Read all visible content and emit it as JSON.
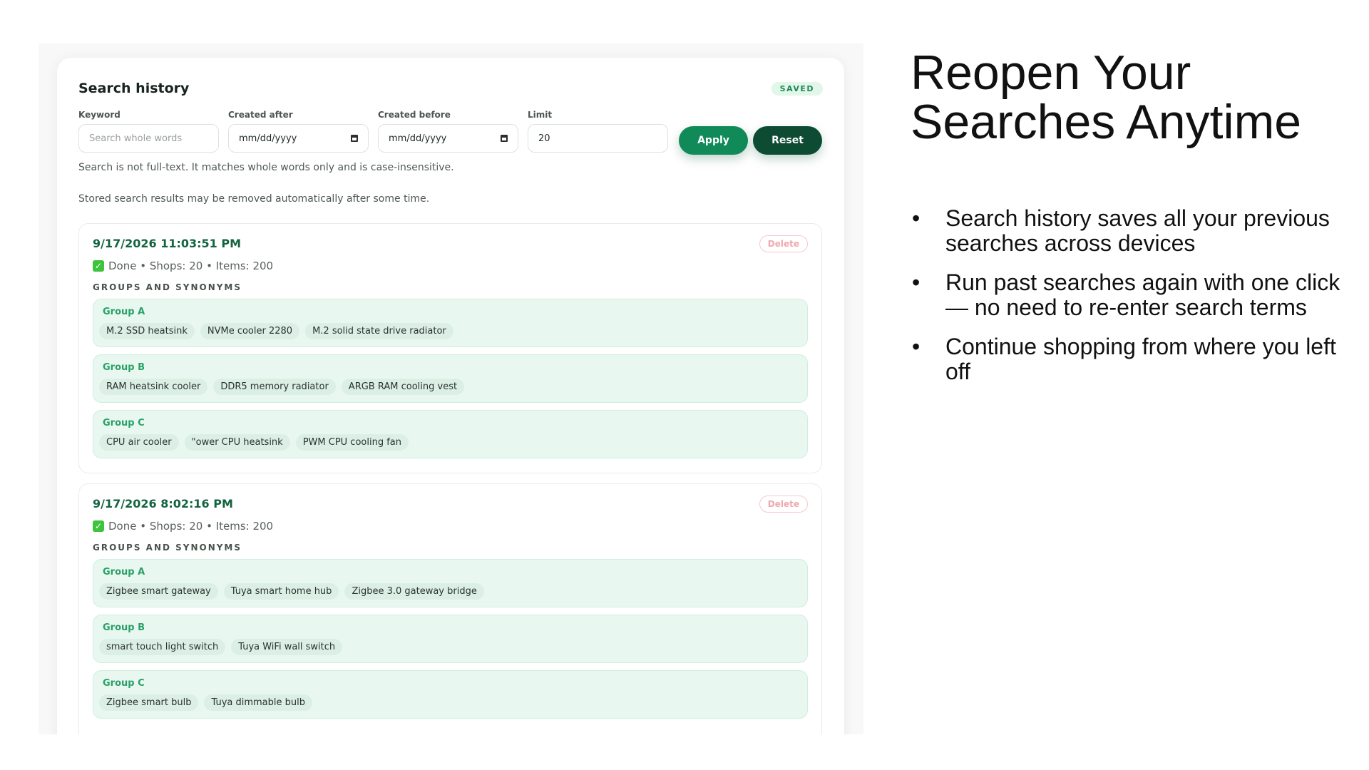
{
  "panel": {
    "title": "Search history",
    "badge": "SAVED",
    "filters": {
      "keyword": {
        "label": "Keyword",
        "placeholder": "Search whole words"
      },
      "created_after": {
        "label": "Created after",
        "value": "mm/dd/yyyy"
      },
      "created_before": {
        "label": "Created before",
        "value": "mm/dd/yyyy"
      },
      "limit": {
        "label": "Limit",
        "value": "20"
      }
    },
    "apply_label": "Apply",
    "reset_label": "Reset",
    "note_fulltext": "Search is not full-text. It matches whole words only and is case-insensitive.",
    "note_retention": "Stored search results may be removed automatically after some time."
  },
  "entries": [
    {
      "timestamp": "9/17/2026 11:03:51 PM",
      "delete_label": "Delete",
      "status": "Done • Shops: 20 • Items: 200",
      "groups_heading": "GROUPS AND SYNONYMS",
      "groups": [
        {
          "name": "Group A",
          "terms": [
            "M.2 SSD heatsink",
            "NVMe cooler 2280",
            "M.2 solid state drive radiator"
          ]
        },
        {
          "name": "Group B",
          "terms": [
            "RAM heatsink cooler",
            "DDR5 memory radiator",
            "ARGB RAM cooling vest"
          ]
        },
        {
          "name": "Group C",
          "terms": [
            "CPU air cooler",
            "\"ower CPU heatsink",
            "PWM CPU cooling fan"
          ]
        }
      ]
    },
    {
      "timestamp": "9/17/2026 8:02:16 PM",
      "delete_label": "Delete",
      "status": "Done • Shops: 20 • Items: 200",
      "groups_heading": "GROUPS AND SYNONYMS",
      "groups": [
        {
          "name": "Group A",
          "terms": [
            "Zigbee smart gateway",
            "Tuya smart home hub",
            "Zigbee 3.0 gateway bridge"
          ]
        },
        {
          "name": "Group B",
          "terms": [
            "smart touch light switch",
            "Tuya WiFi wall switch"
          ]
        },
        {
          "name": "Group C",
          "terms": [
            "Zigbee smart bulb",
            "Tuya dimmable bulb"
          ]
        }
      ]
    }
  ],
  "slide": {
    "title_line1": "Reopen Your",
    "title_line2": "Searches Anytime",
    "bullets": [
      "Search history saves all your previous searches across devices",
      "Run past searches again with one click — no need to re-enter search terms",
      "Continue shopping from where you left off"
    ]
  },
  "colors": {
    "accent": "#0f8a58",
    "accent_dark": "#0e4b33",
    "group_bg": "#e8f8f1",
    "timestamp": "#13643f",
    "delete": "#f0a8ae"
  },
  "icons": {
    "done": "check-icon",
    "date": "calendar-icon"
  }
}
